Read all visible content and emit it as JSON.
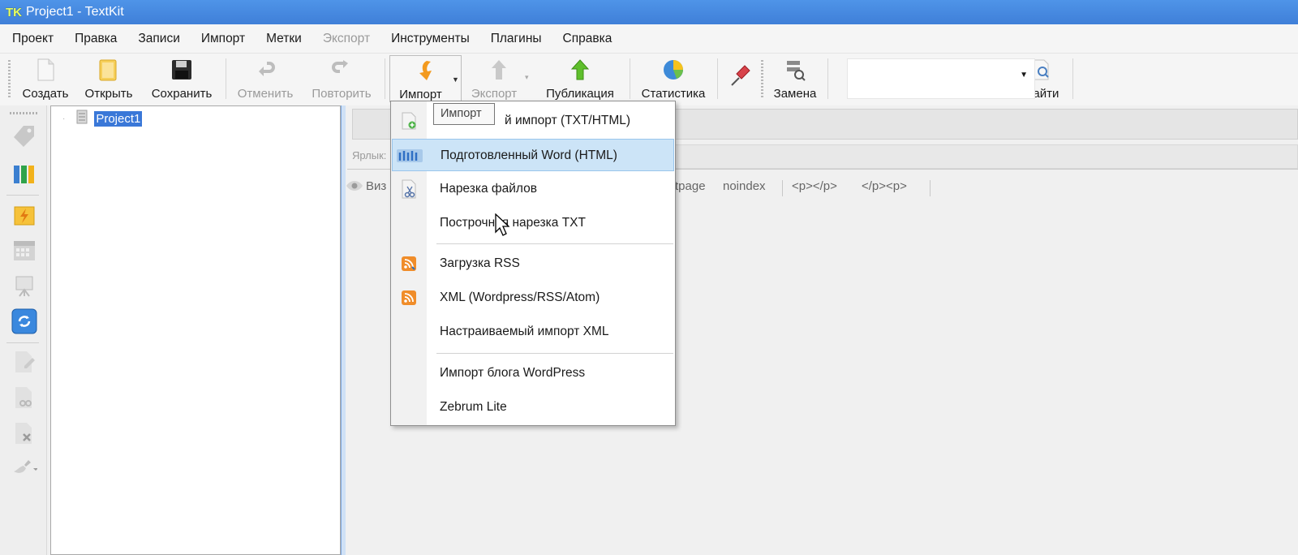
{
  "window": {
    "title": "Project1 - TextKit",
    "logo_text": "TK"
  },
  "menubar": [
    "Проект",
    "Правка",
    "Записи",
    "Импорт",
    "Метки",
    "Экспорт",
    "Инструменты",
    "Плагины",
    "Справка"
  ],
  "toolbar": {
    "create": "Создать",
    "open": "Открыть",
    "save": "Сохранить",
    "undo": "Отменить",
    "redo": "Повторить",
    "import": "Импорт",
    "export": "Экспорт",
    "publish": "Публикация",
    "stats": "Статистика",
    "replace": "Замена",
    "find": "Найти"
  },
  "tree": {
    "root_label": "Project1"
  },
  "editor": {
    "label_field": "Ярлык:",
    "view_partial": "Виз",
    "tags": [
      "tpage",
      "noindex",
      "<p></p>",
      "</p><p>"
    ]
  },
  "tooltip": "Импорт",
  "import_menu": {
    "items": [
      "Быстрый импорт (TXT/HTML)",
      "Подготовленный Word (HTML)",
      "Нарезка файлов",
      "Построчная нарезка TXT",
      "Загрузка RSS",
      "XML (Wordpress/RSS/Atom)",
      "Настраиваемый импорт XML",
      "Импорт блога WordPress",
      "Zebrum Lite"
    ],
    "first_item_visible": "й импорт (TXT/HTML)",
    "selected_index": 1
  },
  "colors": {
    "titlebar": "#3f7fd8",
    "selection": "#cce4f7",
    "tree_selection": "#3a78d8"
  }
}
